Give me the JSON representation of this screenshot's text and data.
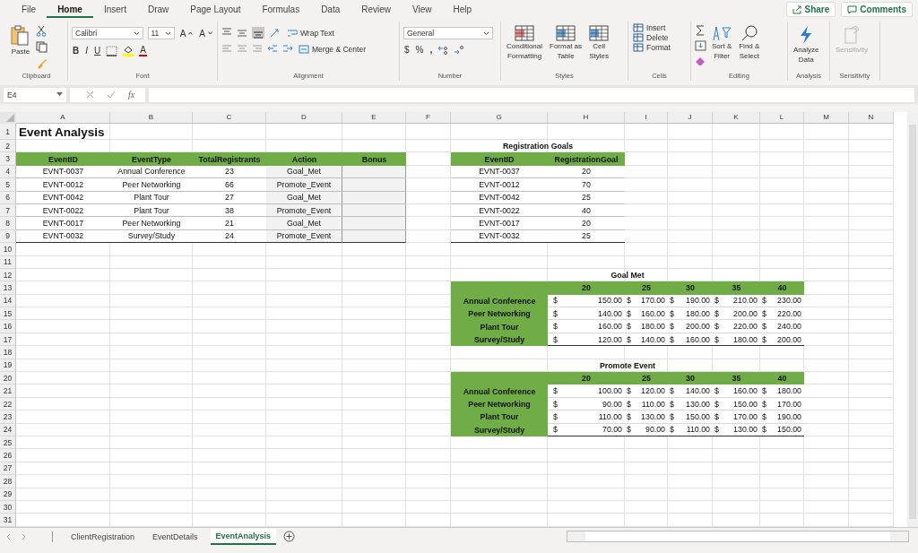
{
  "menu": [
    {
      "label": "File",
      "selected": false
    },
    {
      "label": "Home",
      "selected": true
    },
    {
      "label": "Insert",
      "selected": false
    },
    {
      "label": "Draw",
      "selected": false
    },
    {
      "label": "Page Layout",
      "selected": false
    },
    {
      "label": "Formulas",
      "selected": false
    },
    {
      "label": "Data",
      "selected": false
    },
    {
      "label": "Review",
      "selected": false
    },
    {
      "label": "View",
      "selected": false
    },
    {
      "label": "Help",
      "selected": false
    }
  ],
  "share": "Share",
  "comments": "Comments",
  "ribbon": {
    "clipboard": {
      "label": "Clipboard",
      "paste": "Paste"
    },
    "font": {
      "label": "Font",
      "name": "Calibri",
      "size": "11",
      "grow": "A",
      "shrink": "A",
      "bold": "B",
      "italic": "I",
      "underline": "U",
      "font_color_label": "A"
    },
    "alignment": {
      "label": "Alignment",
      "wrap": "Wrap Text",
      "merge": "Merge & Center"
    },
    "number": {
      "label": "Number",
      "format": "General",
      "currency": "$",
      "percent": "%",
      "comma": ","
    },
    "styles": {
      "label": "Styles",
      "buttons": [
        [
          "Conditional",
          "Formatting"
        ],
        [
          "Format as",
          "Table"
        ],
        [
          "Cell",
          "Styles"
        ]
      ]
    },
    "cells": {
      "label": "Cells",
      "buttons": [
        "Insert",
        "Delete",
        "Format"
      ]
    },
    "editing": {
      "label": "Editing",
      "buttons": [
        [
          "Sort &",
          "Filter"
        ],
        [
          "Find &",
          "Select"
        ]
      ]
    },
    "analysis": {
      "label": "Analysis",
      "button": [
        "Analyze",
        "Data"
      ]
    },
    "sensitivity": {
      "label": "Sensitivity",
      "button": "Sensitivity",
      "disabled": true
    }
  },
  "formula_bar": {
    "name_box": "E4",
    "fx": "fx"
  },
  "sheet": {
    "columns": [
      "A",
      "B",
      "C",
      "D",
      "E",
      "F",
      "G",
      "H",
      "I",
      "J",
      "K",
      "L",
      "M",
      "N"
    ],
    "row_numbers": [
      "1",
      "2",
      "3",
      "4",
      "5",
      "6",
      "7",
      "8",
      "9",
      "10",
      "11",
      "12",
      "13",
      "14",
      "15",
      "16",
      "17",
      "18",
      "19",
      "20",
      "21",
      "22",
      "23",
      "24",
      "25",
      "26",
      "27",
      "28",
      "29",
      "30",
      "31"
    ],
    "title": "Event Analysis",
    "event_table": {
      "columns": [
        {
          "label": "EventID",
          "shaded": false
        },
        {
          "label": "EventType",
          "shaded": false
        },
        {
          "label": "TotalRegistrants",
          "shaded": false
        },
        {
          "label": "Action",
          "shaded": true
        },
        {
          "label": "Bonus",
          "shaded": true
        }
      ],
      "rows": [
        [
          "EVNT-0037",
          "Annual Conference",
          "23",
          "Goal_Met"
        ],
        [
          "EVNT-0012",
          "Peer Networking",
          "66",
          "Promote_Event"
        ],
        [
          "EVNT-0042",
          "Plant Tour",
          "27",
          "Goal_Met"
        ],
        [
          "EVNT-0022",
          "Plant Tour",
          "38",
          "Promote_Event"
        ],
        [
          "EVNT-0017",
          "Peer Networking",
          "21",
          "Goal_Met"
        ],
        [
          "EVNT-0032",
          "Survey/Study",
          "24",
          "Promote_Event"
        ]
      ]
    },
    "goals_table": {
      "title": "Registration Goals",
      "columns": [
        "EventID",
        "RegistrationGoal"
      ],
      "rows": [
        [
          "EVNT-0037",
          "20"
        ],
        [
          "EVNT-0012",
          "70"
        ],
        [
          "EVNT-0042",
          "25"
        ],
        [
          "EVNT-0022",
          "40"
        ],
        [
          "EVNT-0017",
          "20"
        ],
        [
          "EVNT-0032",
          "25"
        ]
      ]
    },
    "bonus_tables": [
      {
        "title": "Goal Met",
        "columns": [
          "20",
          "25",
          "30",
          "35",
          "40"
        ],
        "rows": [
          {
            "label": "Annual Conference",
            "values": [
              [
                "$",
                "150.00"
              ],
              [
                "$",
                "170.00"
              ],
              [
                "$",
                "190.00"
              ],
              [
                "$",
                "210.00"
              ],
              [
                "$",
                "230.00"
              ]
            ]
          },
          {
            "label": "Peer Networking",
            "values": [
              [
                "$",
                "140.00"
              ],
              [
                "$",
                "160.00"
              ],
              [
                "$",
                "180.00"
              ],
              [
                "$",
                "200.00"
              ],
              [
                "$",
                "220.00"
              ]
            ]
          },
          {
            "label": "Plant Tour",
            "values": [
              [
                "$",
                "160.00"
              ],
              [
                "$",
                "180.00"
              ],
              [
                "$",
                "200.00"
              ],
              [
                "$",
                "220.00"
              ],
              [
                "$",
                "240.00"
              ]
            ]
          },
          {
            "label": "Survey/Study",
            "values": [
              [
                "$",
                "120.00"
              ],
              [
                "$",
                "140.00"
              ],
              [
                "$",
                "160.00"
              ],
              [
                "$",
                "180.00"
              ],
              [
                "$",
                "200.00"
              ]
            ]
          }
        ]
      },
      {
        "title": "Promote Event",
        "columns": [
          "20",
          "25",
          "30",
          "35",
          "40"
        ],
        "rows": [
          {
            "label": "Annual Conference",
            "values": [
              [
                "$",
                "100.00"
              ],
              [
                "$",
                "120.00"
              ],
              [
                "$",
                "140.00"
              ],
              [
                "$",
                "160.00"
              ],
              [
                "$",
                "180.00"
              ]
            ]
          },
          {
            "label": "Peer Networking",
            "values": [
              [
                "$",
                "90.00"
              ],
              [
                "$",
                "110.00"
              ],
              [
                "$",
                "130.00"
              ],
              [
                "$",
                "150.00"
              ],
              [
                "$",
                "170.00"
              ]
            ]
          },
          {
            "label": "Plant Tour",
            "values": [
              [
                "$",
                "110.00"
              ],
              [
                "$",
                "130.00"
              ],
              [
                "$",
                "150.00"
              ],
              [
                "$",
                "170.00"
              ],
              [
                "$",
                "190.00"
              ]
            ]
          },
          {
            "label": "Survey/Study",
            "values": [
              [
                "$",
                "70.00"
              ],
              [
                "$",
                "90.00"
              ],
              [
                "$",
                "110.00"
              ],
              [
                "$",
                "130.00"
              ],
              [
                "$",
                "150.00"
              ]
            ]
          }
        ]
      }
    ]
  },
  "sheet_tabs": [
    {
      "label": "ClientRegistration",
      "selected": false
    },
    {
      "label": "EventDetails",
      "selected": false
    },
    {
      "label": "EventAnalysis",
      "selected": true
    }
  ]
}
